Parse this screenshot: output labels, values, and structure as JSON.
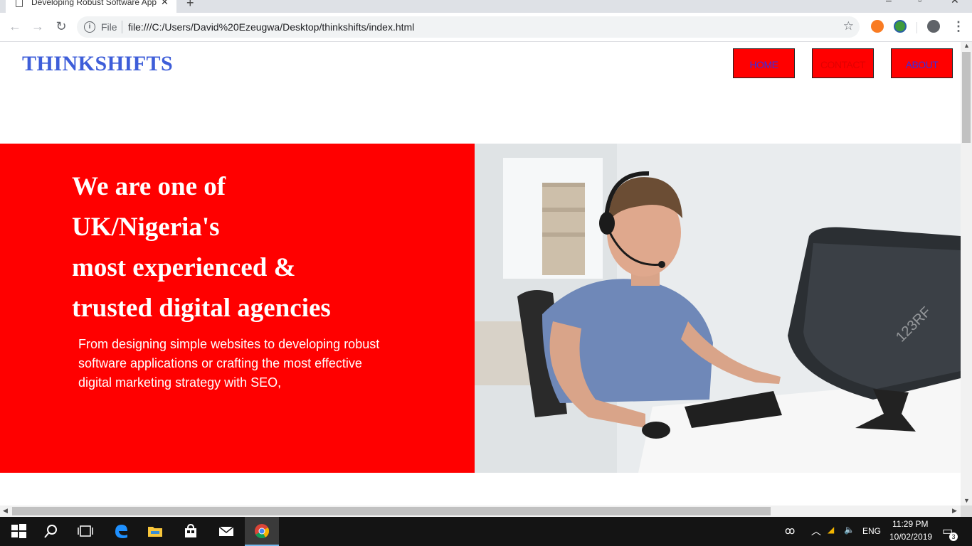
{
  "browser": {
    "tab_title": "Developing Robust Software App",
    "new_tab_icon": "plus-icon",
    "address_scheme": "File",
    "address_url": "file:///C:/Users/David%20Ezeugwa/Desktop/thinkshifts/index.html"
  },
  "site": {
    "logo": "THINKSHIFTS",
    "nav": {
      "home": "HOME",
      "contact": "CONTACT",
      "about": "ABOUT"
    },
    "hero": {
      "headline_lines": [
        "We are one of",
        "UK/Nigeria's",
        "most experienced &",
        "trusted digital agencies"
      ],
      "subtext": "From designing simple websites to developing robust software applications or crafting the most effective digital marketing strategy with SEO,",
      "image_watermark": "123RF"
    }
  },
  "taskbar": {
    "time": "11:29 PM",
    "date": "10/02/2019",
    "language": "ENG",
    "notification_count": "3"
  },
  "colors": {
    "hero_red": "#ff0000",
    "logo_blue": "#3e5ed9",
    "nav_text_blue": "#3a2de0"
  }
}
